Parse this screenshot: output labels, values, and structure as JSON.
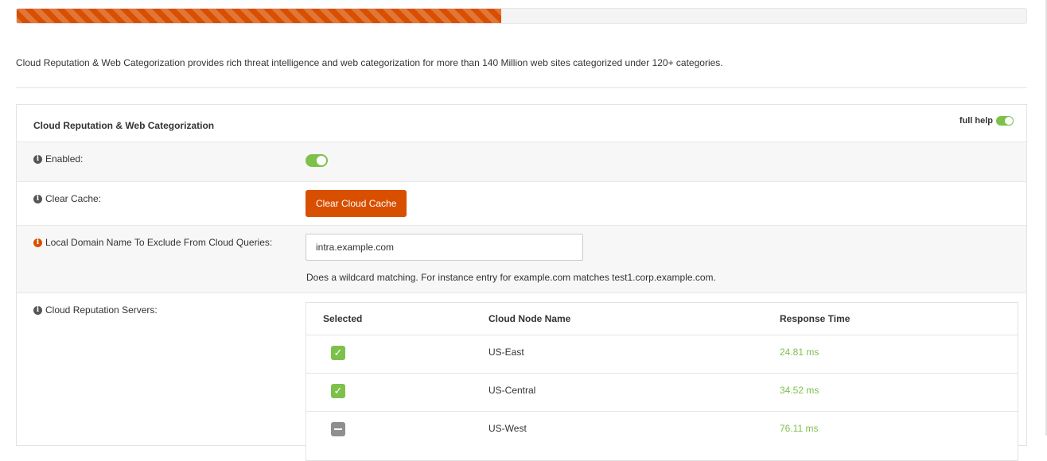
{
  "progress": {
    "percent": 48
  },
  "intro": "Cloud Reputation & Web Categorization provides rich threat intelligence and web categorization for more than 140 Million web sites categorized under 120+ categories.",
  "panel": {
    "title": "Cloud Reputation & Web Categorization",
    "full_help_label": "full help"
  },
  "fields": {
    "enabled": {
      "label": "Enabled:",
      "value": true
    },
    "clear_cache": {
      "label": "Clear Cache:",
      "button": "Clear Cloud Cache"
    },
    "local_domain": {
      "label": "Local Domain Name To Exclude From Cloud Queries:",
      "value": "intra.example.com",
      "hint": "Does a wildcard matching. For instance entry for example.com matches test1.corp.example.com."
    },
    "servers": {
      "label": "Cloud Reputation Servers:",
      "headers": [
        "Selected",
        "Cloud Node Name",
        "Response Time"
      ],
      "rows": [
        {
          "selected": "checked",
          "name": "US-East",
          "response": "24.81 ms"
        },
        {
          "selected": "checked",
          "name": "US-Central",
          "response": "34.52 ms"
        },
        {
          "selected": "partial",
          "name": "US-West",
          "response": "76.11 ms"
        }
      ]
    }
  },
  "colors": {
    "accent": "#d94f00",
    "success": "#7dc14a"
  }
}
